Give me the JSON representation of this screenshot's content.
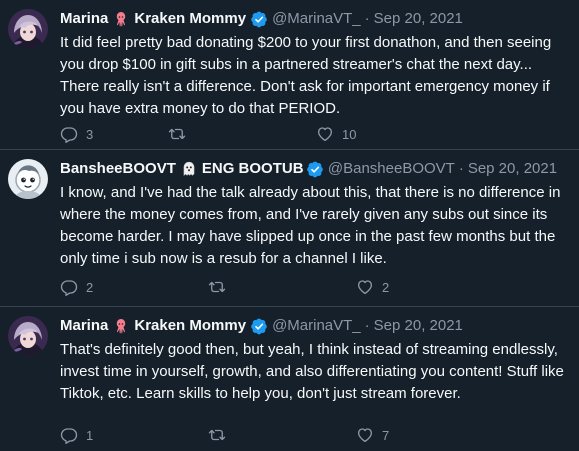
{
  "tweets": [
    {
      "name_first": "Marina",
      "name_second": "Kraken Mommy",
      "handle": "@MarinaVT_",
      "date": "Sep 20, 2021",
      "text": "It did feel pretty bad donating $200 to your first donathon, and then seeing you drop $100 in gift subs in a partnered streamer's chat the next day... There really isn't a difference. Don't ask for important emergency money if you have extra money to do that PERIOD.",
      "replies": "3",
      "retweets": "",
      "likes": "10"
    },
    {
      "name_first": "BansheeBOOVT",
      "name_second": "ENG BOOTUBER",
      "handle": "@BansheeBOOVT",
      "date": "Sep 20, 2021",
      "text": "I know, and I've had the talk already about this, that there is no difference in where the money comes from, and I've rarely given any subs out since its become harder. I may have slipped up once in the past few months but the only time i sub now is a resub for a channel I like.",
      "replies": "2",
      "retweets": "",
      "likes": "2"
    },
    {
      "name_first": "Marina",
      "name_second": "Kraken Mommy",
      "handle": "@MarinaVT_",
      "date": "Sep 20, 2021",
      "text": "That's definitely good then, but yeah, I think instead of streaming endlessly, invest time in yourself, growth, and also differentiating you content! Stuff like Tiktok, etc. Learn skills to help you, don't just stream forever.",
      "replies": "1",
      "retweets": "",
      "likes": "7"
    }
  ],
  "colors": {
    "background": "#15202b",
    "text_primary": "#f7f9f9",
    "text_secondary": "#8b98a5",
    "verified": "#1d9bf0",
    "divider": "#38444d"
  },
  "icons": {
    "reply": "reply-icon",
    "retweet": "retweet-icon",
    "like": "like-icon",
    "verified": "verified-badge-icon",
    "squid": "squid-emoji-icon",
    "ghost": "ghost-emoji-icon"
  }
}
